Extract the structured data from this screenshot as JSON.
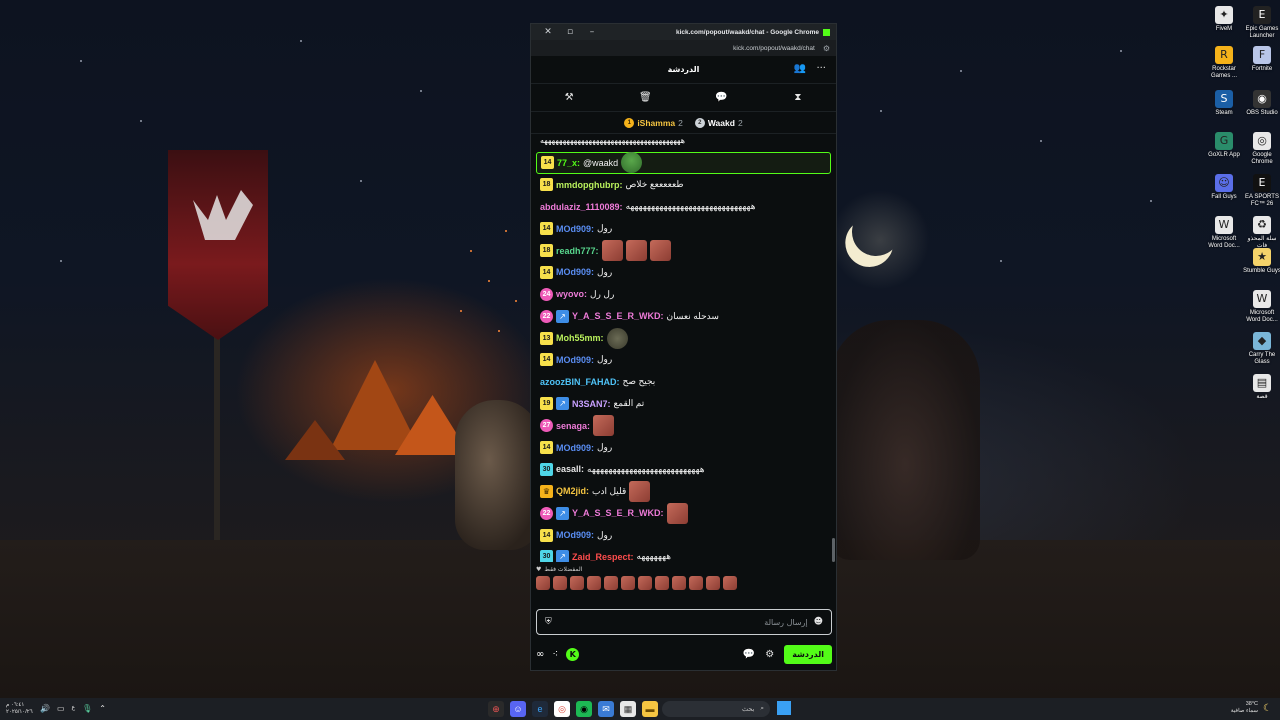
{
  "window": {
    "title": "kick.com/popout/waakd/chat - Google Chrome",
    "url": "kick.com/popout/waakd/chat"
  },
  "chat": {
    "header_title": "الدردشة",
    "top_gifters": [
      {
        "name": "iShamma",
        "count": "2"
      },
      {
        "name": "Waakd",
        "count": "2"
      }
    ],
    "pinned_partial": "ههههههههههههههههههههههههههههههههههههههه",
    "messages": [
      {
        "badge": "14",
        "user": "77_x:",
        "text": "@waakd",
        "emote": "pepe",
        "mention": true,
        "color": "#53fc18"
      },
      {
        "badge": "18",
        "user": "mmdopghubrp:",
        "text": "طعععععع خلاص",
        "color": "#b9f05c"
      },
      {
        "badge": "",
        "user": "abdulaziz_1110089:",
        "text": "ههههههههههههههههههههههههههههههه",
        "color": "#ee7bd8"
      },
      {
        "badge": "14",
        "user": "MOd909:",
        "text": "رول",
        "color": "#5a8df2"
      },
      {
        "badge": "18",
        "user": "readh777:",
        "text": "",
        "emotes": 3,
        "color": "#58d68d"
      },
      {
        "badge": "14",
        "user": "MOd909:",
        "text": "رول",
        "color": "#5a8df2"
      },
      {
        "badge": "24",
        "user": "wyovo:",
        "text": "رل رل",
        "color": "#ee7bd8"
      },
      {
        "badge": "22",
        "user": "Y_A_S_S_E_R_WKD:",
        "text": "سدحله نعسان",
        "color": "#ee7bd8"
      },
      {
        "badge": "13",
        "user": "Moh55mm:",
        "text": "",
        "emote": "rock",
        "color": "#b9f05c"
      },
      {
        "badge": "14",
        "user": "MOd909:",
        "text": "رول",
        "color": "#5a8df2"
      },
      {
        "badge": "",
        "user": "azoozBIN_FAHAD:",
        "text": "بجيح صح",
        "color": "#4fc3f7"
      },
      {
        "badge": "19",
        "user": "N3SAN7:",
        "text": "تم القمع",
        "color": "#c8a0ff"
      },
      {
        "badge": "27",
        "user": "senaga:",
        "text": "",
        "emote": "face",
        "color": "#ee7bd8"
      },
      {
        "badge": "14",
        "user": "MOd909:",
        "text": "رول",
        "color": "#5a8df2"
      },
      {
        "badge": "30",
        "user": "easall:",
        "text": "هههههههههههههههههههههههههههه",
        "color": "#e6e6e6"
      },
      {
        "badge": "crown",
        "user": "QM2jid:",
        "text": "قليل ادب",
        "emote": "face",
        "color": "#f5c542"
      },
      {
        "badge": "22",
        "user": "Y_A_S_S_E_R_WKD:",
        "text": "",
        "emote": "face",
        "color": "#ee7bd8"
      },
      {
        "badge": "14",
        "user": "MOd909:",
        "text": "رول",
        "color": "#5a8df2"
      },
      {
        "badge": "30",
        "user": "Zaid_Respect:",
        "text": "هههههههه",
        "color": "#ff4d4d"
      }
    ],
    "favorites_label": "المفضلات فقط",
    "input_placeholder": "إرسال رسالة",
    "chat_button": "الدردشة"
  },
  "desktop_icons": [
    {
      "label": "FiveM",
      "glyph": "✦",
      "color": "#e8e8e8"
    },
    {
      "label": "Epic Games Launcher",
      "glyph": "E",
      "color": "#222"
    },
    {
      "label": "Rockstar Games ...",
      "glyph": "R",
      "color": "#f5b21a"
    },
    {
      "label": "Fortnite",
      "glyph": "F",
      "color": "#b9c6e8"
    },
    {
      "label": "Steam",
      "glyph": "S",
      "color": "#1b5fa6"
    },
    {
      "label": "OBS Studio",
      "glyph": "◉",
      "color": "#333"
    },
    {
      "label": "GoXLR App",
      "glyph": "G",
      "color": "#2a8c6a"
    },
    {
      "label": "Google Chrome",
      "glyph": "◎",
      "color": "#e8e8e8"
    },
    {
      "label": "Fall Guys",
      "glyph": "☺",
      "color": "#5a6ee8"
    },
    {
      "label": "EA SPORTS FC™ 26",
      "glyph": "E",
      "color": "#111"
    },
    {
      "label": "Microsoft Word Doc...",
      "glyph": "W",
      "color": "#e8e8e8"
    },
    {
      "label": "سلة المحذو فات",
      "glyph": "♻",
      "color": "#e8e8e8"
    },
    {
      "label": "Stumble Guys",
      "glyph": "★",
      "color": "#f5d36a"
    },
    {
      "label": "Microsoft Word Doc...",
      "glyph": "W",
      "color": "#e8e8e8"
    },
    {
      "label": "Carry The Glass",
      "glyph": "◆",
      "color": "#7ab6d8"
    },
    {
      "label": "قصة",
      "glyph": "▤",
      "color": "#e8e8e8"
    }
  ],
  "taskbar": {
    "time": "٠٦:٤١ م",
    "date": "٢٠٢٥/١٠/٢٦",
    "search_label": "بحث",
    "weather_temp": "38°C",
    "weather_desc": "سماء صافية"
  }
}
